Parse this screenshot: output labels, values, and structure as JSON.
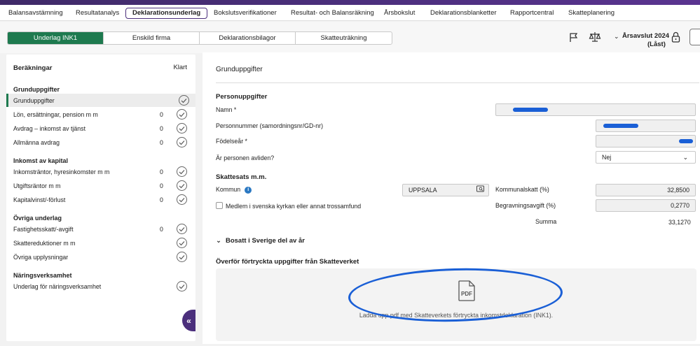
{
  "topnav": {
    "items": [
      "Balansavstämning",
      "Resultatanalys",
      "Deklarationsunderlag",
      "Bokslutsverifikationer",
      "Resultat- och Balansräkning",
      "Årsbokslut",
      "Deklarationsblanketter",
      "Rapportcentral",
      "Skatteplanering"
    ],
    "active_index": 2
  },
  "toolbar": {
    "tabs": [
      "Underlag INK1",
      "Enskild firma",
      "Deklarationsbilagor",
      "Skatteuträkning"
    ],
    "active_index": 0,
    "year_line1": "Årsavslut 2024",
    "year_line2": "(Låst)",
    "icons": [
      "flag-icon",
      "scales-icon",
      "lock-icon",
      "chat-icon"
    ]
  },
  "left": {
    "title": "Beräkningar",
    "status_header": "Klart",
    "categories": [
      {
        "title": "Grunduppgifter",
        "rows": [
          {
            "label": "Grunduppgifter",
            "count": "",
            "active": true
          },
          {
            "label": "Lön, ersättningar, pension m m",
            "count": "0"
          },
          {
            "label": "Avdrag – inkomst av tjänst",
            "count": "0"
          },
          {
            "label": "Allmänna avdrag",
            "count": "0"
          }
        ]
      },
      {
        "title": "Inkomst av kapital",
        "rows": [
          {
            "label": "Inkomsträntor, hyresinkomster m m",
            "count": "0"
          },
          {
            "label": "Utgiftsräntor m m",
            "count": "0"
          },
          {
            "label": "Kapitalvinst/-förlust",
            "count": "0"
          }
        ]
      },
      {
        "title": "Övriga underlag",
        "rows": [
          {
            "label": "Fastighetsskatt/-avgift",
            "count": "0"
          },
          {
            "label": "Skattereduktioner m m",
            "count": ""
          },
          {
            "label": "Övriga upplysningar",
            "count": ""
          }
        ]
      },
      {
        "title": "Näringsverksamhet",
        "rows": [
          {
            "label": "Underlag för näringsverksamhet",
            "count": ""
          }
        ]
      }
    ]
  },
  "main": {
    "title": "Grunduppgifter",
    "person": {
      "section": "Personuppgifter",
      "name_label": "Namn *",
      "pnr_label": "Personnummer (samordningsnr/GD-nr)",
      "birth_label": "Födelseår *",
      "deceased_label": "Är personen avliden?",
      "deceased_value": "Nej"
    },
    "tax": {
      "section": "Skattesats m.m.",
      "kommun_label": "Kommun",
      "kommun_value": "UPPSALA",
      "church_label": "Medlem i svenska kyrkan eller annat trossamfund",
      "kommunalskatt_label": "Kommunalskatt (%)",
      "kommunalskatt_value": "32,8500",
      "begravning_label": "Begravningsavgift (%)",
      "begravning_value": "0,2770",
      "summa_label": "Summa",
      "summa_value": "33,1270"
    },
    "bosatt_label": "Bosatt i Sverige del av år",
    "transfer": {
      "section": "Överför förtryckta uppgifter från Skatteverket",
      "dropzone_text": "Ladda upp pdf med Skatteverkets förtryckta inkomstdeklaration (INK1).",
      "pdf_label": "PDF"
    }
  },
  "colors": {
    "accent_green": "#1e7a4f",
    "brand_purple": "#4b2f7c",
    "annotation_blue": "#1a5fd6"
  }
}
